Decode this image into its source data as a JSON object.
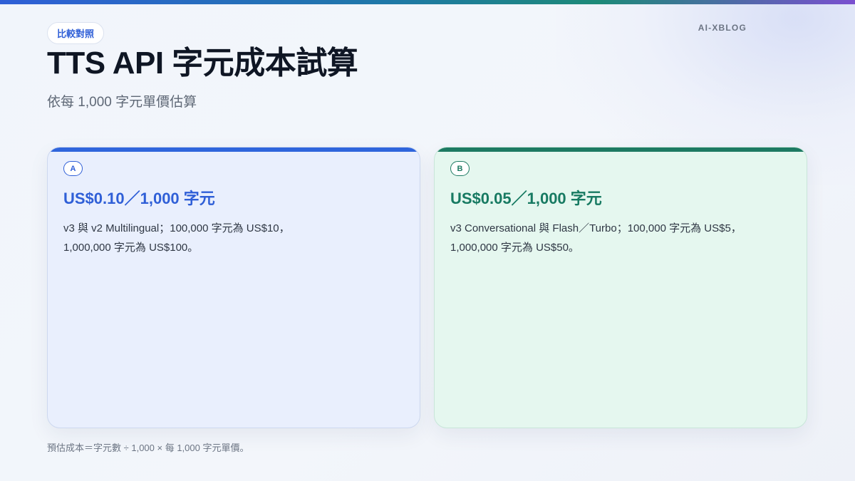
{
  "header": {
    "badge": "比較對照",
    "title": "TTS API 字元成本試算",
    "subtitle": "依每 1,000 字元單價估算",
    "brand": "AI-XBLOG"
  },
  "cards": [
    {
      "letter": "A",
      "price": "US$0.10／1,000 字元",
      "description": "v3 與 v2 Multilingual；100,000 字元為 US$10，1,000,000 字元為 US$100。",
      "accent_color": "#2f65dc"
    },
    {
      "letter": "B",
      "price": "US$0.05／1,000 字元",
      "description": "v3 Conversational 與 Flash／Turbo；100,000 字元為 US$5，1,000,000 字元為 US$50。",
      "accent_color": "#1d7a62"
    }
  ],
  "footnote": "預估成本＝字元數 ÷ 1,000 × 每 1,000 字元單價。"
}
